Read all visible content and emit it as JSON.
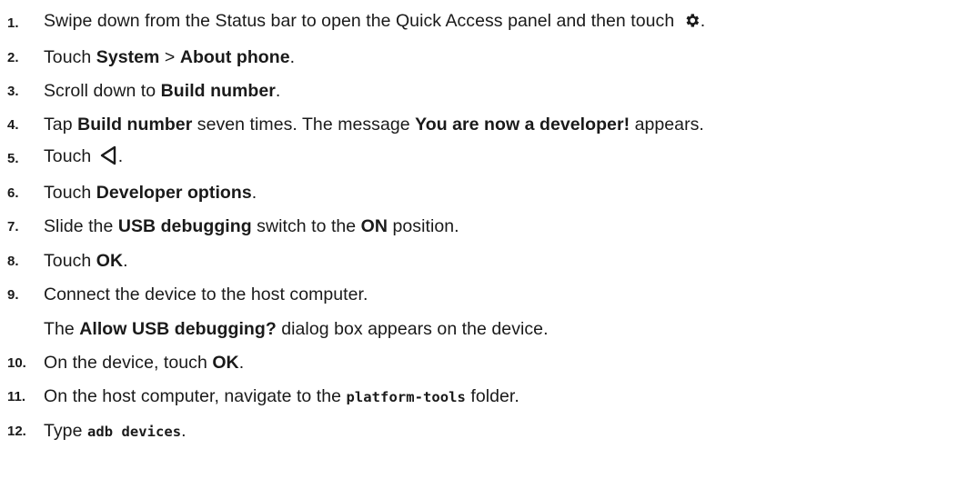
{
  "steps": [
    {
      "num": "1.",
      "parts": [
        "Swipe down from the Status bar to open the Quick Access panel and then touch",
        "."
      ],
      "icon": "gear-icon"
    },
    {
      "num": "2.",
      "parts": [
        "Touch ",
        "System",
        " > ",
        "About phone",
        "."
      ]
    },
    {
      "num": "3.",
      "parts": [
        "Scroll down to ",
        "Build number",
        "."
      ]
    },
    {
      "num": "4.",
      "parts": [
        "Tap ",
        "Build number",
        " seven times. The message ",
        "You are now a developer!",
        " appears."
      ]
    },
    {
      "num": "5.",
      "parts": [
        "Touch ",
        "."
      ],
      "icon": "back-icon"
    },
    {
      "num": "6.",
      "parts": [
        "Touch ",
        "Developer options",
        "."
      ]
    },
    {
      "num": "7.",
      "parts": [
        "Slide the ",
        "USB debugging",
        " switch to the ",
        "ON",
        " position."
      ]
    },
    {
      "num": "8.",
      "parts": [
        "Touch ",
        "OK",
        "."
      ]
    },
    {
      "num": "9.",
      "parts": [
        "Connect the device to the host computer."
      ]
    },
    {
      "num": "",
      "parts": [
        "The ",
        "Allow USB debugging?",
        " dialog box appears on the device."
      ]
    },
    {
      "num": "10.",
      "parts": [
        "On the device, touch ",
        "OK",
        "."
      ]
    },
    {
      "num": "11.",
      "parts": [
        "On the host computer, navigate to the ",
        "platform-tools",
        " folder."
      ]
    },
    {
      "num": "12.",
      "parts": [
        "Type ",
        "adb devices",
        "."
      ]
    }
  ]
}
